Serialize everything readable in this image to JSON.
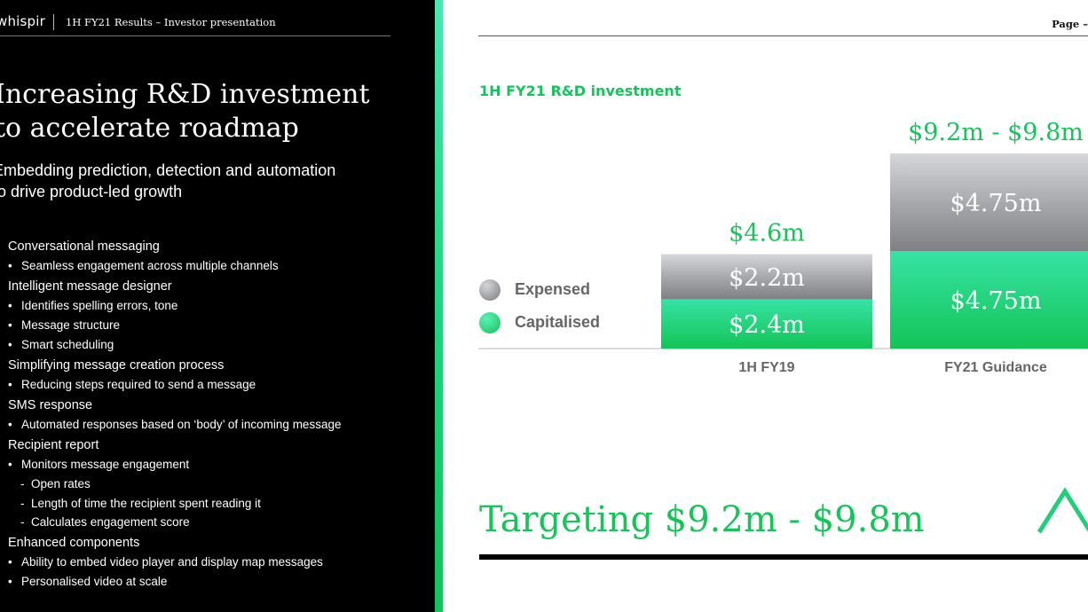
{
  "header": {
    "brand": "whispir",
    "subtitle": "1H FY21 Results – Investor presentation"
  },
  "slide": {
    "title_line1": "Increasing R&D investment",
    "title_line2": "to accelerate roadmap",
    "subtitle_line1": "Embedding prediction, detection and automation",
    "subtitle_line2": "to drive product-led growth"
  },
  "sections": [
    {
      "heading": "Conversational messaging",
      "items": [
        {
          "text": "Seamless engagement across multiple channels",
          "subs": []
        }
      ]
    },
    {
      "heading": "Intelligent message designer",
      "items": [
        {
          "text": "Identifies spelling errors, tone",
          "subs": []
        },
        {
          "text": "Message structure",
          "subs": []
        },
        {
          "text": "Smart scheduling",
          "subs": []
        }
      ]
    },
    {
      "heading": "Simplifying message creation process",
      "items": [
        {
          "text": "Reducing steps required to send a message",
          "subs": []
        }
      ]
    },
    {
      "heading": "SMS response",
      "items": [
        {
          "text": "Automated responses based on ‘body’ of incoming message",
          "subs": []
        }
      ]
    },
    {
      "heading": "Recipient report",
      "items": [
        {
          "text": "Monitors message engagement",
          "subs": [
            "Open rates",
            "Length of time the recipient spent reading it",
            "Calculates engagement score"
          ]
        }
      ]
    },
    {
      "heading": "Enhanced components",
      "items": [
        {
          "text": "Ability to embed video player and display map messages",
          "subs": []
        },
        {
          "text": "Personalised video at scale",
          "subs": []
        }
      ]
    }
  ],
  "page_label": "Page –",
  "chart_title": "1H FY21 R&D investment",
  "chart_data": {
    "type": "bar",
    "stacked": true,
    "title": "1H FY21 R&D investment",
    "categories": [
      "1H FY19",
      "FY21 Guidance"
    ],
    "series": [
      {
        "name": "Capitalised",
        "values": [
          2.4,
          4.75
        ],
        "labels": [
          "$2.4m",
          "$4.75m"
        ],
        "color": "#1fd67f"
      },
      {
        "name": "Expensed",
        "values": [
          2.2,
          4.75
        ],
        "labels": [
          "$2.2m",
          "$4.75m"
        ],
        "color": "#9d9ea2"
      }
    ],
    "totals": [
      "$4.6m",
      "$9.2m - $9.8m"
    ],
    "legend_position": "left",
    "grid": false,
    "ylim": [
      0,
      9.8
    ]
  },
  "colors": {
    "accent": "#17c45a",
    "expensed": "#9d9ea2",
    "capitalised": "#1fd67f",
    "dark_bg": "#000000"
  },
  "legend": [
    {
      "label": "Expensed",
      "color": "#9d9ea2"
    },
    {
      "label": "Capitalised",
      "color": "#1fd67f"
    }
  ],
  "target_text": "Targeting $9.2m - $9.8m",
  "decor_icon": "chevron-up-icon"
}
